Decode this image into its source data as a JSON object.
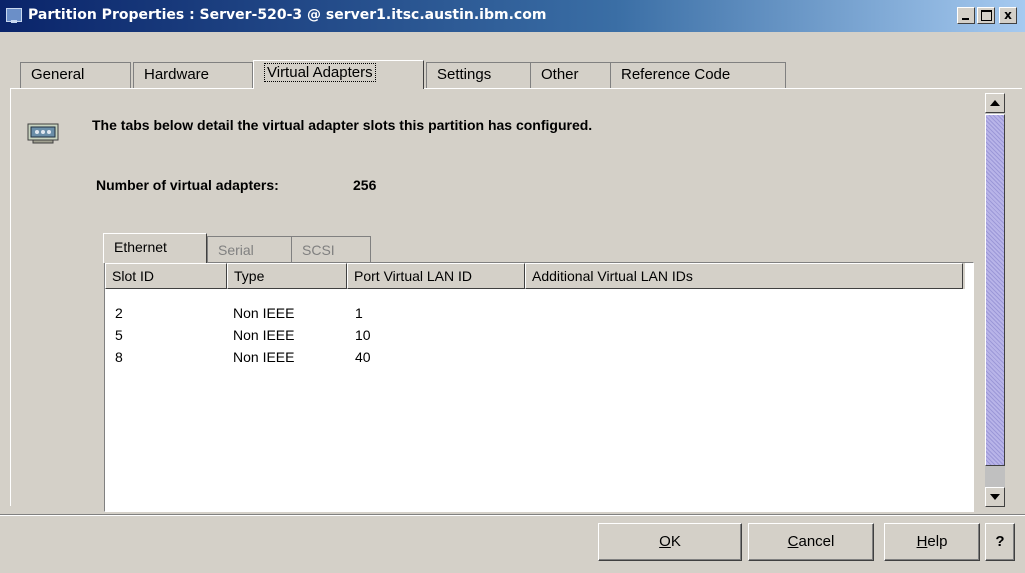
{
  "window": {
    "title": "Partition Properties : Server-520-3 @ server1.itsc.austin.ibm.com",
    "minimize_label": "_",
    "maximize_label": "□",
    "close_label": "x"
  },
  "main_tabs": [
    {
      "label": "General"
    },
    {
      "label": "Hardware"
    },
    {
      "label": "Virtual Adapters",
      "selected": true
    },
    {
      "label": "Settings"
    },
    {
      "label": "Other"
    },
    {
      "label": "Reference Code"
    }
  ],
  "content": {
    "description": "The tabs below detail the virtual adapter slots this partition has configured.",
    "count_label": "Number of virtual adapters:",
    "count_value": "256"
  },
  "sub_tabs": [
    {
      "label": "Ethernet",
      "selected": true
    },
    {
      "label": "Serial"
    },
    {
      "label": "SCSI"
    }
  ],
  "table": {
    "columns": [
      "Slot ID",
      "Type",
      "Port Virtual LAN ID",
      "Additional Virtual LAN IDs"
    ],
    "rows": [
      [
        "2",
        "Non IEEE",
        "1",
        ""
      ],
      [
        "5",
        "Non IEEE",
        "10",
        ""
      ],
      [
        "8",
        "Non IEEE",
        "40",
        ""
      ]
    ]
  },
  "buttons": {
    "ok": {
      "mnemonic": "O",
      "rest": "K"
    },
    "cancel": {
      "mnemonic": "C",
      "rest": "ancel"
    },
    "help": {
      "mnemonic": "H",
      "rest": "elp"
    },
    "context_help": "?"
  },
  "icons": {
    "title_icon": "window-app-icon",
    "adapter_icon": "network-adapter-icon"
  },
  "colors": {
    "titlebar_start": "#0a246a",
    "titlebar_end": "#a6caf0",
    "window_bg": "#d4d0c8",
    "scroll_thumb": "#b8b4e8"
  }
}
